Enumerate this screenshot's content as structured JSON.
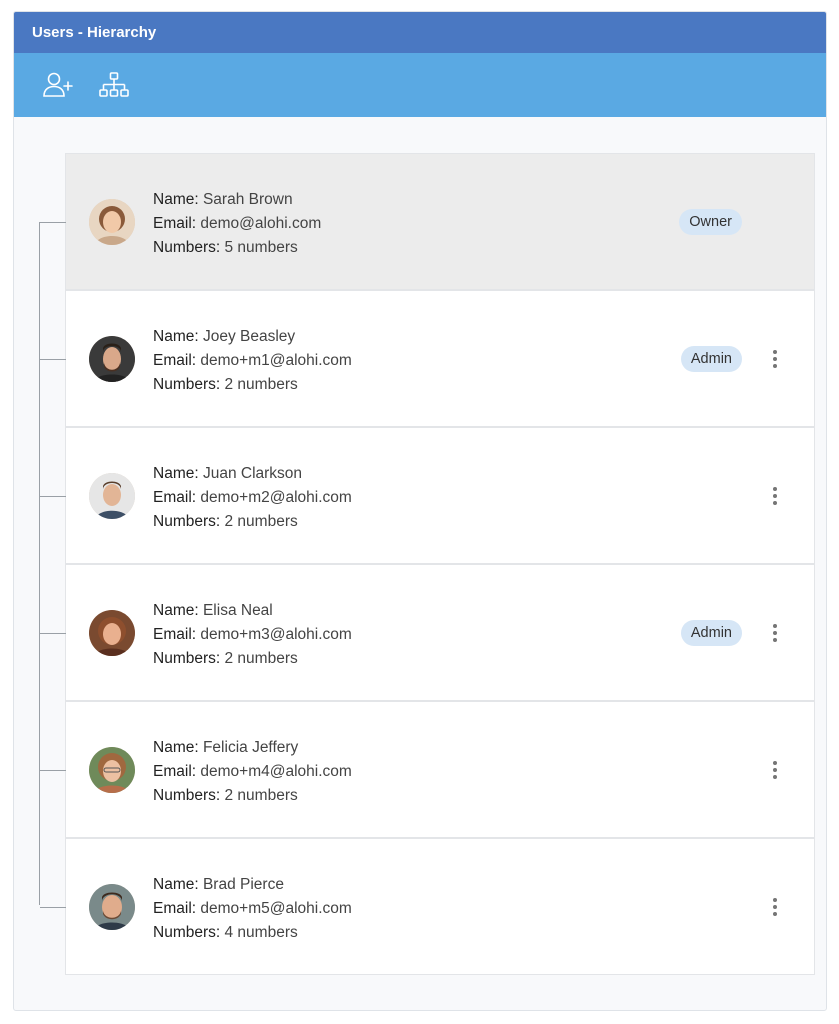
{
  "window": {
    "title": "Users - Hierarchy"
  },
  "toolbar": {
    "add_user_icon": "user-plus-icon",
    "hierarchy_icon": "org-chart-icon"
  },
  "labels": {
    "name": "Name:",
    "email": "Email:",
    "numbers": "Numbers:"
  },
  "colors": {
    "title_bar": "#4a78c2",
    "toolbar": "#5aa9e3",
    "badge": "#d6e6f6",
    "highlight_row": "#ececec"
  },
  "users": [
    {
      "name": "Sarah Brown",
      "email": "demo@alohi.com",
      "numbers": "5 numbers",
      "badge": "Owner",
      "has_menu": false,
      "highlighted": true
    },
    {
      "name": "Joey Beasley",
      "email": "demo+m1@alohi.com",
      "numbers": "2 numbers",
      "badge": "Admin",
      "has_menu": true,
      "highlighted": false
    },
    {
      "name": "Juan Clarkson",
      "email": "demo+m2@alohi.com",
      "numbers": "2 numbers",
      "badge": "",
      "has_menu": true,
      "highlighted": false
    },
    {
      "name": "Elisa Neal",
      "email": "demo+m3@alohi.com",
      "numbers": "2 numbers",
      "badge": "Admin",
      "has_menu": true,
      "highlighted": false
    },
    {
      "name": "Felicia Jeffery",
      "email": "demo+m4@alohi.com",
      "numbers": "2 numbers",
      "badge": "",
      "has_menu": true,
      "highlighted": false
    },
    {
      "name": "Brad Pierce",
      "email": "demo+m5@alohi.com",
      "numbers": "4 numbers",
      "badge": "",
      "has_menu": true,
      "highlighted": false
    }
  ]
}
